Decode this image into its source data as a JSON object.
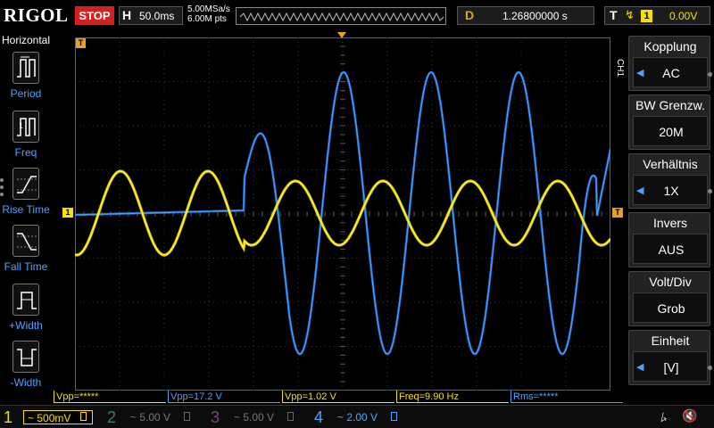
{
  "header": {
    "brand": "RIGOL",
    "run_state": "STOP",
    "horizontal_key": "H",
    "timebase": "50.0ms",
    "sample_rate": "5.00MSa/s",
    "memory_depth": "6.00M pts",
    "delay_key": "D",
    "delay_value": "1.26800000 s",
    "trigger_key": "T",
    "trigger_edge_icon": "rising-edge-icon",
    "trigger_source": "1",
    "trigger_level": "0.00V"
  },
  "left_menu": {
    "title": "Horizontal",
    "items": [
      {
        "label": "Period",
        "icon": "period-icon"
      },
      {
        "label": "Freq",
        "icon": "freq-icon"
      },
      {
        "label": "Rise Time",
        "icon": "rise-time-icon"
      },
      {
        "label": "Fall Time",
        "icon": "fall-time-icon"
      },
      {
        "label": "+Width",
        "icon": "plus-width-icon"
      },
      {
        "label": "-Width",
        "icon": "minus-width-icon"
      }
    ]
  },
  "right_menu": {
    "channel_tab": "CH1",
    "items": [
      {
        "title": "Kopplung",
        "value": "AC",
        "arrow": true
      },
      {
        "title": "BW Grenzw.",
        "value": "20M",
        "arrow": false
      },
      {
        "title": "Verhältnis",
        "value": "1X",
        "arrow": true
      },
      {
        "title": "Invers",
        "value": "AUS",
        "arrow": false
      },
      {
        "title": "Volt/Div",
        "value": "Grob",
        "arrow": false
      },
      {
        "title": "Einheit",
        "value": "[V]",
        "arrow": true
      }
    ]
  },
  "grid_markers": {
    "trigger_position": "T",
    "ch1_level": "1",
    "trigger_level": "T"
  },
  "measurements": [
    {
      "text": "Vpp=*****",
      "color": "yellow"
    },
    {
      "text": "Vpp=17.2 V",
      "color": "blue"
    },
    {
      "text": "Vpp=1.02 V",
      "color": "yellow"
    },
    {
      "text": "Freq=9.90 Hz",
      "color": "yellow"
    },
    {
      "text": "Rms=*****",
      "color": "blue"
    }
  ],
  "channels": [
    {
      "num": "1",
      "scale": "~ 500mV",
      "color": "#f5e000",
      "active": true
    },
    {
      "num": "2",
      "scale": "~ 5.00 V",
      "color": "#3aa0a0",
      "active": false
    },
    {
      "num": "3",
      "scale": "~ 5.00 V",
      "color": "#c040c0",
      "active": false
    },
    {
      "num": "4",
      "scale": "~ 2.00 V",
      "color": "#4ea3ff",
      "active": true
    }
  ],
  "status_icons": [
    "usb-icon",
    "speaker-muted-icon"
  ],
  "colors": {
    "ch1": "#f5e000",
    "ch4": "#1e6fd0",
    "accent": "#e8a020",
    "stop": "#d42020"
  }
}
